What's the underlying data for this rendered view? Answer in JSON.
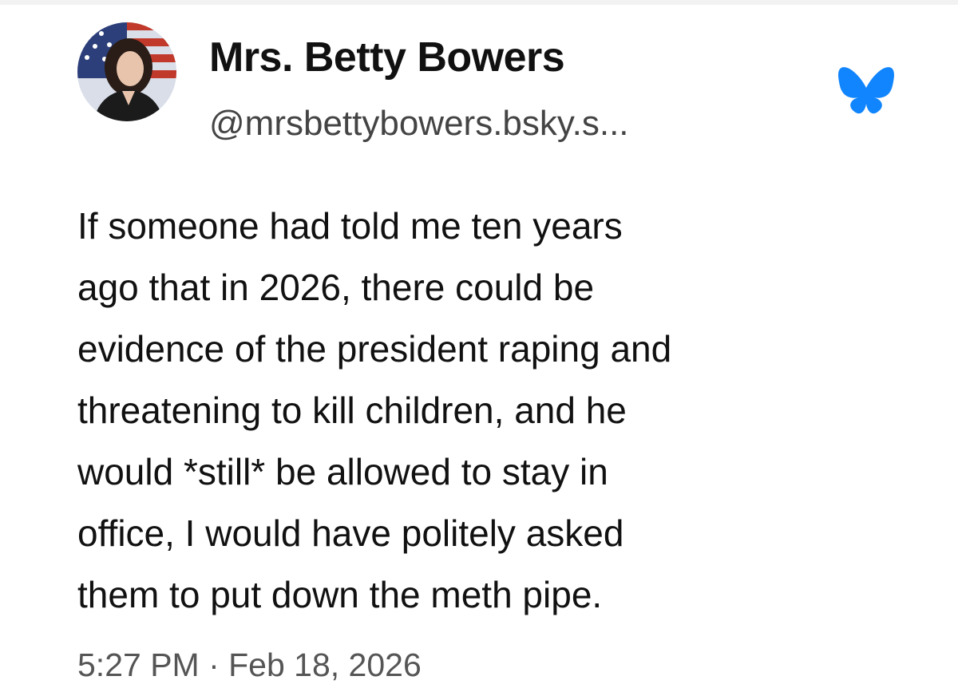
{
  "post": {
    "author": {
      "display_name": "Mrs. Betty Bowers",
      "handle": "@mrsbettybowers.bsky.s..."
    },
    "platform_icon": "bluesky-butterfly-icon",
    "text_lines": [
      "If someone had told me ten years",
      "ago that in 2026, there could be",
      "evidence of the president raping and",
      "threatening to kill children, and he",
      "would *still* be allowed to stay in",
      "office, I would have politely asked",
      "them to put down the meth pipe."
    ],
    "timestamp": "5:27 PM · Feb 18, 2026"
  },
  "colors": {
    "brand": "#1185fe",
    "text": "#111111",
    "muted": "#555555"
  }
}
